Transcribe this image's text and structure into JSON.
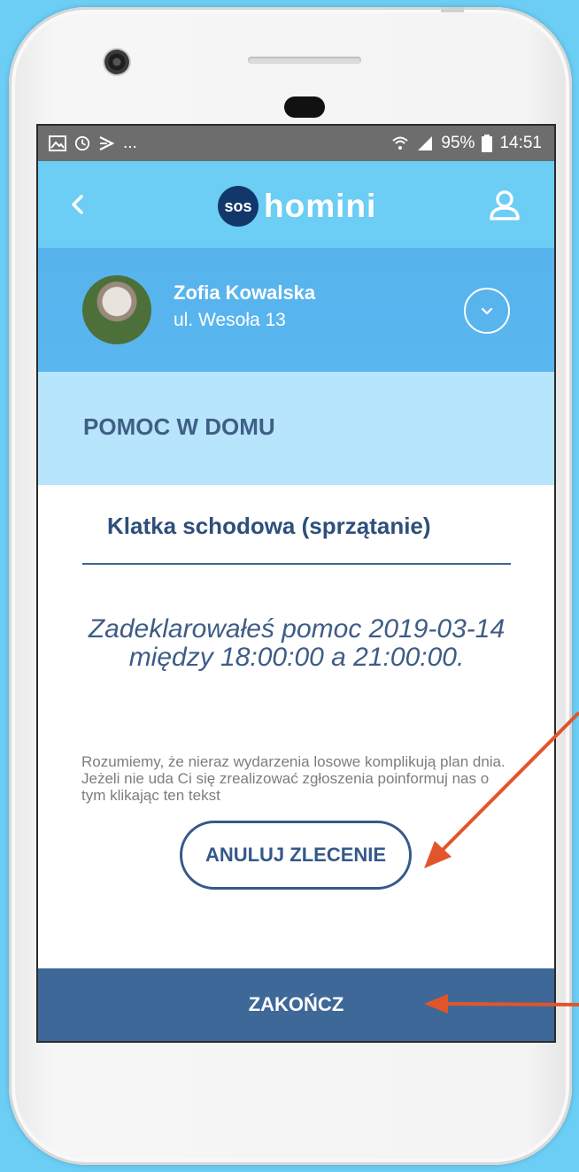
{
  "status_bar": {
    "dots": "...",
    "battery": "95%",
    "time": "14:51"
  },
  "app_bar": {
    "logo_badge": "sos",
    "logo_text": "homini"
  },
  "profile": {
    "name": "Zofia Kowalska",
    "address": "ul. Wesoła 13"
  },
  "category": {
    "title": "POMOC W DOMU"
  },
  "task": {
    "title": "Klatka schodowa (sprzątanie)",
    "declared": "Zadeklarowałeś pomoc 2019-03-14 między 18:00:00 a 21:00:00.",
    "info": "Rozumiemy, że nieraz wydarzenia losowe komplikują plan dnia. Jeżeli nie uda Ci się zrealizować zgłoszenia poinformuj nas o tym klikając ten tekst",
    "cancel_label": "ANULUJ ZLECENIE",
    "finish_label": "ZAKOŃCZ"
  },
  "colors": {
    "background": "#6ccdf5",
    "app_bar": "#6ccdf5",
    "profile_band": "#58b3ec",
    "category_band": "#b7e5fc",
    "navy": "#3e6898",
    "annotation_arrow": "#e2552a"
  },
  "icons": [
    "gallery-icon",
    "sync-icon",
    "cast-icon",
    "wifi-icon",
    "signal-icon",
    "battery-icon",
    "back-chevron-icon",
    "user-icon",
    "chevron-down-icon"
  ]
}
